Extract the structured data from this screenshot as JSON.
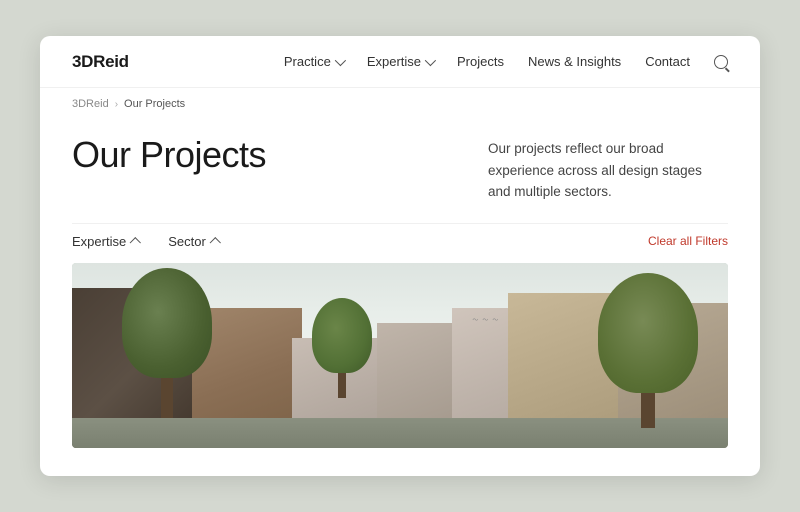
{
  "brand": {
    "logo": "3DReid"
  },
  "nav": {
    "items": [
      {
        "label": "Practice",
        "has_dropdown": true
      },
      {
        "label": "Expertise",
        "has_dropdown": true
      },
      {
        "label": "Projects",
        "has_dropdown": false
      },
      {
        "label": "News & Insights",
        "has_dropdown": false
      },
      {
        "label": "Contact",
        "has_dropdown": false
      }
    ]
  },
  "breadcrumb": {
    "home": "3DReid",
    "separator": "›",
    "current": "Our Projects"
  },
  "hero": {
    "title": "Our Projects",
    "description": "Our projects reflect our broad experience across all design stages and multiple sectors."
  },
  "filters": {
    "expertise_label": "Expertise",
    "sector_label": "Sector",
    "clear_label": "Clear all Filters"
  }
}
